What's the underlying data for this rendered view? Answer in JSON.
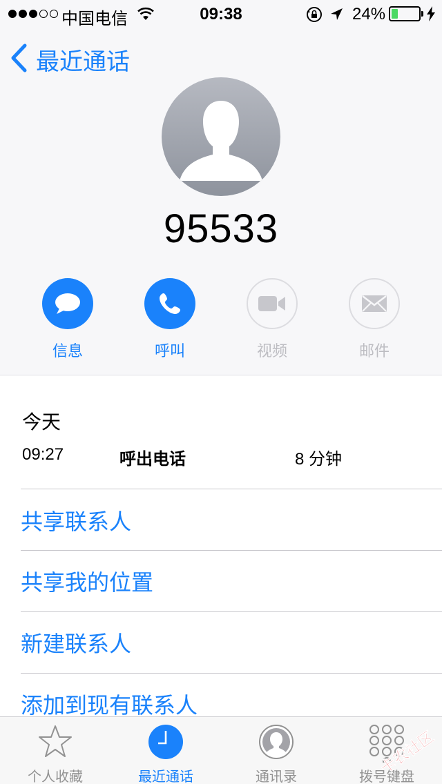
{
  "status_bar": {
    "carrier": "中国电信",
    "time": "09:38",
    "battery_percent": "24%",
    "battery_level": 0.24,
    "signal_bars_filled": 3,
    "signal_bars_total": 5
  },
  "nav": {
    "back_label": "最近通话"
  },
  "contact": {
    "number": "95533"
  },
  "actions": [
    {
      "label": "信息",
      "enabled": true,
      "icon": "message-icon"
    },
    {
      "label": "呼叫",
      "enabled": true,
      "icon": "phone-icon"
    },
    {
      "label": "视频",
      "enabled": false,
      "icon": "video-icon"
    },
    {
      "label": "邮件",
      "enabled": false,
      "icon": "mail-icon"
    }
  ],
  "history": {
    "date_label": "今天",
    "calls": [
      {
        "time": "09:27",
        "type": "呼出电话",
        "duration": "8 分钟"
      }
    ]
  },
  "menu": {
    "share_contact": "共享联系人",
    "share_location": "共享我的位置",
    "new_contact": "新建联系人",
    "add_existing": "添加到现有联系人"
  },
  "tabs": [
    {
      "label": "个人收藏",
      "icon": "star-icon",
      "active": false
    },
    {
      "label": "最近通话",
      "icon": "clock-icon",
      "active": true
    },
    {
      "label": "通讯录",
      "icon": "contacts-icon",
      "active": false
    },
    {
      "label": "拨号键盘",
      "icon": "keypad-icon",
      "active": false
    }
  ],
  "watermark": {
    "text": "卡农社区"
  },
  "colors": {
    "accent": "#1a82fb",
    "disabled": "#bdbdc2",
    "battery": "#4cd964"
  }
}
